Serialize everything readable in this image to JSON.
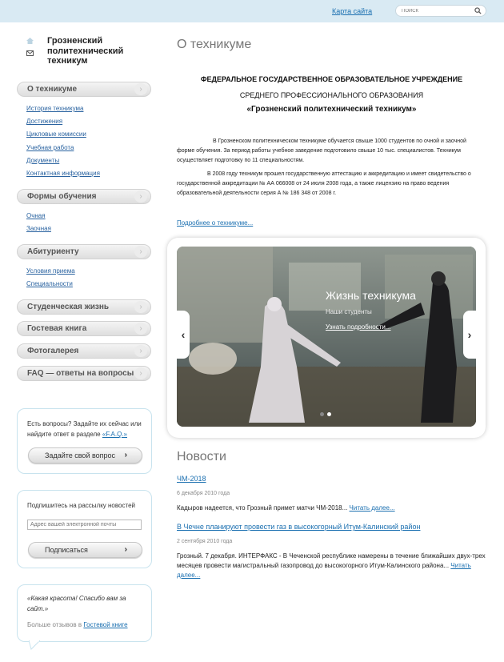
{
  "header": {
    "sitemap_label": "Карта сайта",
    "search_placeholder": "ПОИСК"
  },
  "logo": {
    "title": "Грозненский политехнический техникум",
    "icons": [
      "home-icon",
      "mail-icon"
    ]
  },
  "nav": {
    "sections": [
      {
        "label": "О техникуме",
        "items": [
          "История техникума",
          "Достижения",
          "Цикловые комиссии",
          "Учебная работа",
          "Документы",
          "Контактная информация"
        ]
      },
      {
        "label": "Формы обучения",
        "items": [
          "Очная",
          "Заочная"
        ]
      },
      {
        "label": "Абитуриенту",
        "items": [
          "Условия приема",
          "Специальности"
        ]
      },
      {
        "label": "Студенческая жизнь",
        "items": []
      },
      {
        "label": "Гостевая книга",
        "items": []
      },
      {
        "label": "Фотогалерея",
        "items": []
      },
      {
        "label": "FAQ — ответы на вопросы",
        "items": []
      }
    ]
  },
  "faq_box": {
    "text": "Есть вопросы? Задайте их сейчас или найдите ответ в разделе",
    "link": "«F.A.Q.»",
    "button": "Задайте свой вопрос"
  },
  "subscribe_box": {
    "title": "Подпишитесь на рассылку новостей",
    "placeholder": "Адрес вашей электронной почты",
    "button": "Подписаться"
  },
  "review_box": {
    "quote": "«Какая красота! Спасибо вам за сайт.»",
    "more_prefix": "Больше отзывов в",
    "more_link": "Гостевой книге"
  },
  "main": {
    "title": "О техникуме",
    "heading_line1": "ФЕДЕРАЛЬНОЕ ГОСУДАРСТВЕННОЕ ОБРАЗОВАТЕЛЬНОЕ УЧРЕЖДЕНИЕ",
    "heading_line2": "СРЕДНЕГО ПРОФЕССИОНАЛЬНОГО ОБРАЗОВАНИЯ",
    "heading_line3": "«Грозненский политехнический техникум»",
    "para1": "В Грозненском политехническом техникуме обучается свыше 1000 студентов по очной и заочной форме обучения. За период работы учебное заведение подготовило свыше 10 тыс. специалистов. Техникум осуществляет подготовку по 11 специальностям.",
    "para2": "В 2008 году техникум прошел государственную аттестацию и аккредитацию и имеет свидетельство о государственной аккредитации № АА 066008 от 24 июля 2008 года, а также лицензию на право ведения образовательной деятельности серия А № 186 348 от 2008 г.",
    "more_link": "Подробнее о техникуме..."
  },
  "slider": {
    "caption": "Жизнь техникума",
    "subtitle": "Наши студенты",
    "link": "Узнать подробности...",
    "prev": "‹",
    "next": "›"
  },
  "news": {
    "title": "Новости",
    "items": [
      {
        "title": "ЧМ-2018",
        "date": "6 декабря 2010 года",
        "text": "Кадыров надеется, что Грозный примет матчи ЧМ-2018...",
        "more": "Читать далее..."
      },
      {
        "title": "В Чечне планируют провести газ в высокогорный Итум-Калинский район",
        "date": "2 сентября 2010 года",
        "text": "Грозный. 7 декабря. ИНТЕРФАКС - В Чеченской республике намерены в течение ближайших двух-трех месяцев провести магистральный газопровод до высокогорного Итум-Калинского района...",
        "more": "Читать далее..."
      }
    ]
  },
  "colors": {
    "topbar": "#d9eaf3",
    "link": "#1a6fb0",
    "box_border": "#c8e3ee"
  }
}
